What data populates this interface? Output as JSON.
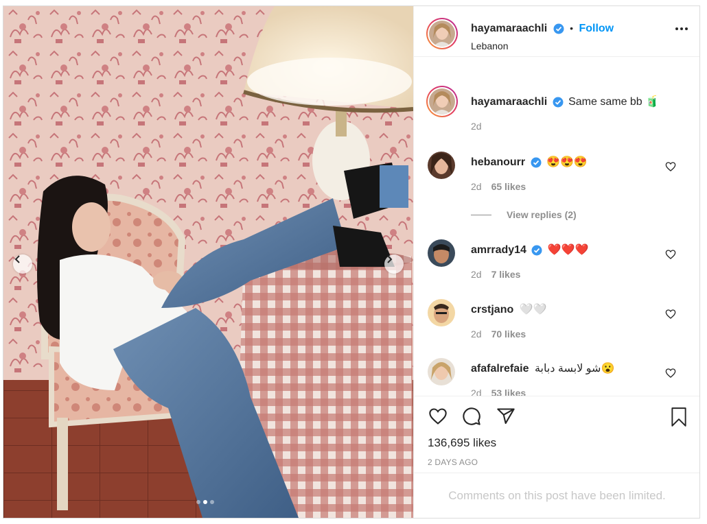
{
  "post": {
    "username": "hayamaraachli",
    "follow_label": "Follow",
    "separator": "•",
    "location": "Lebanon",
    "caption": "Same same bb 🧃",
    "caption_time": "2d",
    "likes": "136,695 likes",
    "time_ago": "2 DAYS AGO",
    "comments_limited": "Comments on this post have been limited."
  },
  "comments": [
    {
      "username": "hebanourr",
      "verified": true,
      "text": "😍😍😍",
      "time": "2d",
      "likes": "65 likes",
      "replies": "View replies (2)"
    },
    {
      "username": "amrrady14",
      "verified": true,
      "text": "❤️❤️❤️",
      "time": "2d",
      "likes": "7 likes"
    },
    {
      "username": "crstjano",
      "verified": false,
      "text": "🤍🤍",
      "time": "2d",
      "likes": "70 likes"
    },
    {
      "username": "afafalrefaie",
      "verified": false,
      "text": "شو لابسة دبابة😮",
      "time": "2d",
      "likes": "53 likes"
    }
  ],
  "carousel": {
    "slides": 3,
    "active_index": 1
  },
  "icons": {
    "prev": "chevron-left-icon",
    "next": "chevron-right-icon",
    "more": "more-options-icon",
    "verified": "verified-badge-icon",
    "like": "heart-icon",
    "comment": "comment-icon",
    "share": "share-icon",
    "save": "bookmark-icon"
  },
  "colors": {
    "accent": "#0095f6",
    "muted": "#8e8e8e",
    "text": "#262626",
    "border": "#dbdbdb",
    "ring_start": "#f9a13a",
    "ring_end": "#b62a9a"
  }
}
